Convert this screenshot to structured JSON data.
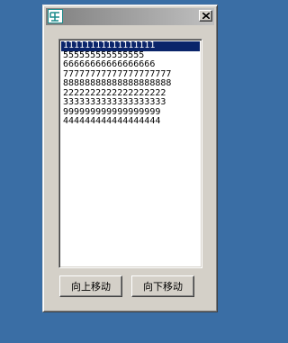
{
  "window": {
    "icon": "app-icon",
    "close_icon": "close-icon"
  },
  "list": {
    "selected_index": 0,
    "items": [
      "11111111111111111",
      "555555555555555",
      "66666666666666666",
      "77777777777777777777",
      "88888888888888888888",
      "2222222222222222222",
      "3333333333333333333",
      "999999999999999999",
      "444444444444444444"
    ]
  },
  "buttons": {
    "move_up_label": "向上移动",
    "move_down_label": "向下移动"
  },
  "colors": {
    "desktop": "#3a6ea5",
    "selection": "#0a246a",
    "window_face": "#d4d0c8"
  }
}
